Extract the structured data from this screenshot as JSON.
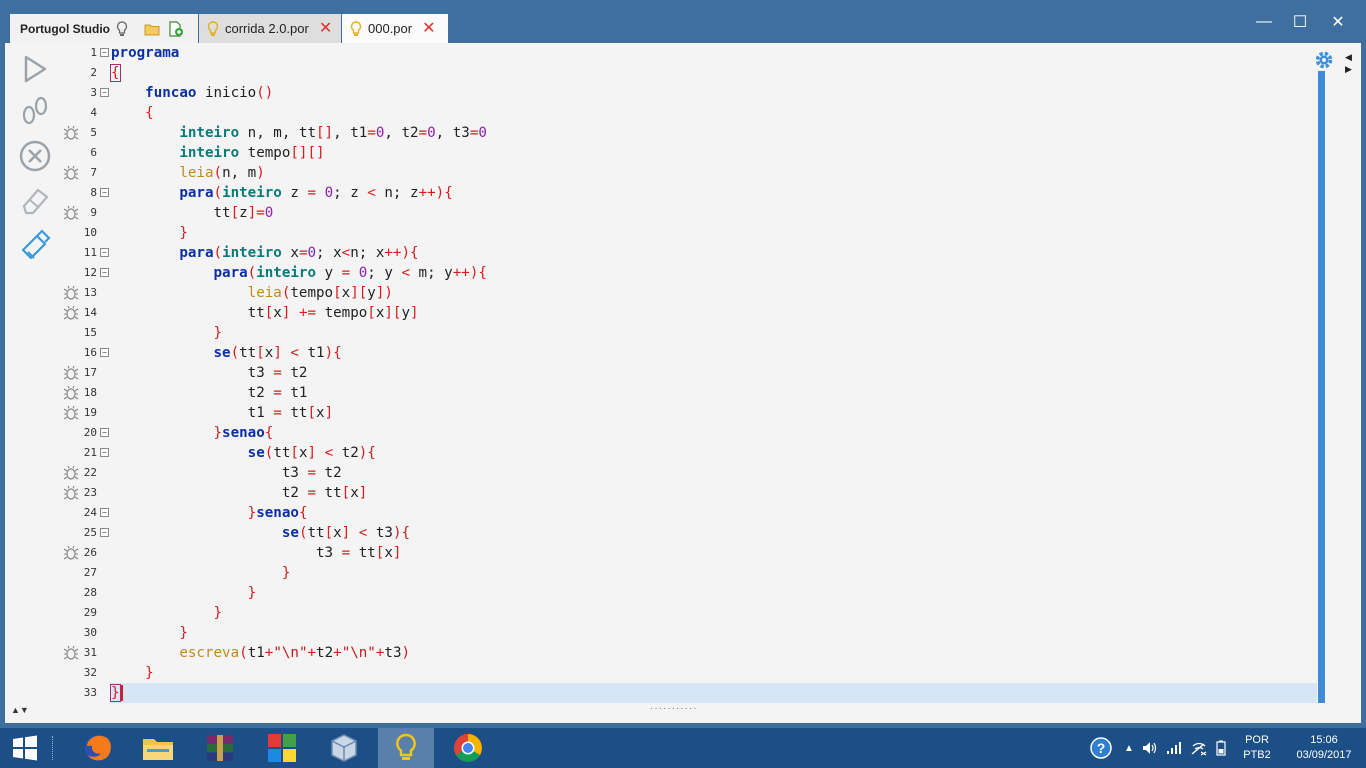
{
  "app": {
    "title": "Portugol Studio"
  },
  "tabs": [
    {
      "label": "corrida 2.0.por",
      "active": false
    },
    {
      "label": "000.por",
      "active": true
    }
  ],
  "window_controls": {
    "minimize": "—",
    "maximize": "☐",
    "close": "✕"
  },
  "toolbar": [
    {
      "name": "run-button",
      "icon": "play-icon"
    },
    {
      "name": "step-button",
      "icon": "footsteps-icon"
    },
    {
      "name": "stop-button",
      "icon": "stop-icon"
    },
    {
      "name": "edit-button",
      "icon": "eraser-icon"
    },
    {
      "name": "deploy-button",
      "icon": "usb-icon"
    }
  ],
  "editor": {
    "current_line": 33,
    "lines": [
      {
        "n": 1,
        "fold": true,
        "bug": false
      },
      {
        "n": 2,
        "fold": false,
        "bug": false
      },
      {
        "n": 3,
        "fold": true,
        "bug": false
      },
      {
        "n": 4,
        "fold": false,
        "bug": false
      },
      {
        "n": 5,
        "fold": false,
        "bug": true
      },
      {
        "n": 6,
        "fold": false,
        "bug": false
      },
      {
        "n": 7,
        "fold": false,
        "bug": true
      },
      {
        "n": 8,
        "fold": true,
        "bug": false
      },
      {
        "n": 9,
        "fold": false,
        "bug": true
      },
      {
        "n": 10,
        "fold": false,
        "bug": false
      },
      {
        "n": 11,
        "fold": true,
        "bug": false
      },
      {
        "n": 12,
        "fold": true,
        "bug": false
      },
      {
        "n": 13,
        "fold": false,
        "bug": true
      },
      {
        "n": 14,
        "fold": false,
        "bug": true
      },
      {
        "n": 15,
        "fold": false,
        "bug": false
      },
      {
        "n": 16,
        "fold": true,
        "bug": false
      },
      {
        "n": 17,
        "fold": false,
        "bug": true
      },
      {
        "n": 18,
        "fold": false,
        "bug": true
      },
      {
        "n": 19,
        "fold": false,
        "bug": true
      },
      {
        "n": 20,
        "fold": true,
        "bug": false
      },
      {
        "n": 21,
        "fold": true,
        "bug": false
      },
      {
        "n": 22,
        "fold": false,
        "bug": true
      },
      {
        "n": 23,
        "fold": false,
        "bug": true
      },
      {
        "n": 24,
        "fold": true,
        "bug": false
      },
      {
        "n": 25,
        "fold": true,
        "bug": false
      },
      {
        "n": 26,
        "fold": false,
        "bug": true
      },
      {
        "n": 27,
        "fold": false,
        "bug": false
      },
      {
        "n": 28,
        "fold": false,
        "bug": false
      },
      {
        "n": 29,
        "fold": false,
        "bug": false
      },
      {
        "n": 30,
        "fold": false,
        "bug": false
      },
      {
        "n": 31,
        "fold": false,
        "bug": true
      },
      {
        "n": 32,
        "fold": false,
        "bug": false
      },
      {
        "n": 33,
        "fold": false,
        "bug": false
      }
    ],
    "code": [
      [
        [
          "k",
          "programa"
        ]
      ],
      [
        [
          "b",
          "{"
        ]
      ],
      [
        [
          "p",
          "    "
        ],
        [
          "k",
          "funcao"
        ],
        [
          "p",
          " inicio"
        ],
        [
          "b",
          "()"
        ]
      ],
      [
        [
          "p",
          "    "
        ],
        [
          "b",
          "{"
        ]
      ],
      [
        [
          "p",
          "        "
        ],
        [
          "t",
          "inteiro"
        ],
        [
          "p",
          " n, m, tt"
        ],
        [
          "b",
          "[]"
        ],
        [
          "p",
          ", t1"
        ],
        [
          "o",
          "="
        ],
        [
          "n",
          "0"
        ],
        [
          "p",
          ", t2"
        ],
        [
          "o",
          "="
        ],
        [
          "n",
          "0"
        ],
        [
          "p",
          ", t3"
        ],
        [
          "o",
          "="
        ],
        [
          "n",
          "0"
        ]
      ],
      [
        [
          "p",
          "        "
        ],
        [
          "t",
          "inteiro"
        ],
        [
          "p",
          " tempo"
        ],
        [
          "b",
          "[][]"
        ]
      ],
      [
        [
          "p",
          "        "
        ],
        [
          "f",
          "leia"
        ],
        [
          "b",
          "("
        ],
        [
          "p",
          "n, m"
        ],
        [
          "b",
          ")"
        ]
      ],
      [
        [
          "p",
          "        "
        ],
        [
          "k",
          "para"
        ],
        [
          "b",
          "("
        ],
        [
          "t",
          "inteiro"
        ],
        [
          "p",
          " z "
        ],
        [
          "o",
          "="
        ],
        [
          "p",
          " "
        ],
        [
          "n",
          "0"
        ],
        [
          "p",
          "; z "
        ],
        [
          "o",
          "<"
        ],
        [
          "p",
          " n; z"
        ],
        [
          "o",
          "++"
        ],
        [
          "b",
          "){"
        ]
      ],
      [
        [
          "p",
          "            tt"
        ],
        [
          "b",
          "["
        ],
        [
          "p",
          "z"
        ],
        [
          "b",
          "]"
        ],
        [
          "o",
          "="
        ],
        [
          "n",
          "0"
        ]
      ],
      [
        [
          "p",
          "        "
        ],
        [
          "b",
          "}"
        ]
      ],
      [
        [
          "p",
          "        "
        ],
        [
          "k",
          "para"
        ],
        [
          "b",
          "("
        ],
        [
          "t",
          "inteiro"
        ],
        [
          "p",
          " x"
        ],
        [
          "o",
          "="
        ],
        [
          "n",
          "0"
        ],
        [
          "p",
          "; x"
        ],
        [
          "o",
          "<"
        ],
        [
          "p",
          "n; x"
        ],
        [
          "o",
          "++"
        ],
        [
          "b",
          "){"
        ]
      ],
      [
        [
          "p",
          "            "
        ],
        [
          "k",
          "para"
        ],
        [
          "b",
          "("
        ],
        [
          "t",
          "inteiro"
        ],
        [
          "p",
          " y "
        ],
        [
          "o",
          "="
        ],
        [
          "p",
          " "
        ],
        [
          "n",
          "0"
        ],
        [
          "p",
          "; y "
        ],
        [
          "o",
          "<"
        ],
        [
          "p",
          " m; y"
        ],
        [
          "o",
          "++"
        ],
        [
          "b",
          "){"
        ]
      ],
      [
        [
          "p",
          "                "
        ],
        [
          "f",
          "leia"
        ],
        [
          "b",
          "("
        ],
        [
          "p",
          "tempo"
        ],
        [
          "b",
          "["
        ],
        [
          "p",
          "x"
        ],
        [
          "b",
          "]["
        ],
        [
          "p",
          "y"
        ],
        [
          "b",
          "])"
        ]
      ],
      [
        [
          "p",
          "                tt"
        ],
        [
          "b",
          "["
        ],
        [
          "p",
          "x"
        ],
        [
          "b",
          "]"
        ],
        [
          "p",
          " "
        ],
        [
          "o",
          "+="
        ],
        [
          "p",
          " tempo"
        ],
        [
          "b",
          "["
        ],
        [
          "p",
          "x"
        ],
        [
          "b",
          "]["
        ],
        [
          "p",
          "y"
        ],
        [
          "b",
          "]"
        ]
      ],
      [
        [
          "p",
          "            "
        ],
        [
          "b",
          "}"
        ]
      ],
      [
        [
          "p",
          "            "
        ],
        [
          "k",
          "se"
        ],
        [
          "b",
          "("
        ],
        [
          "p",
          "tt"
        ],
        [
          "b",
          "["
        ],
        [
          "p",
          "x"
        ],
        [
          "b",
          "]"
        ],
        [
          "p",
          " "
        ],
        [
          "o",
          "<"
        ],
        [
          "p",
          " t1"
        ],
        [
          "b",
          "){"
        ]
      ],
      [
        [
          "p",
          "                t3 "
        ],
        [
          "o",
          "="
        ],
        [
          "p",
          " t2"
        ]
      ],
      [
        [
          "p",
          "                t2 "
        ],
        [
          "o",
          "="
        ],
        [
          "p",
          " t1"
        ]
      ],
      [
        [
          "p",
          "                t1 "
        ],
        [
          "o",
          "="
        ],
        [
          "p",
          " tt"
        ],
        [
          "b",
          "["
        ],
        [
          "p",
          "x"
        ],
        [
          "b",
          "]"
        ]
      ],
      [
        [
          "p",
          "            "
        ],
        [
          "b",
          "}"
        ],
        [
          "k",
          "senao"
        ],
        [
          "b",
          "{"
        ]
      ],
      [
        [
          "p",
          "                "
        ],
        [
          "k",
          "se"
        ],
        [
          "b",
          "("
        ],
        [
          "p",
          "tt"
        ],
        [
          "b",
          "["
        ],
        [
          "p",
          "x"
        ],
        [
          "b",
          "]"
        ],
        [
          "p",
          " "
        ],
        [
          "o",
          "<"
        ],
        [
          "p",
          " t2"
        ],
        [
          "b",
          "){"
        ]
      ],
      [
        [
          "p",
          "                    t3 "
        ],
        [
          "o",
          "="
        ],
        [
          "p",
          " t2"
        ]
      ],
      [
        [
          "p",
          "                    t2 "
        ],
        [
          "o",
          "="
        ],
        [
          "p",
          " tt"
        ],
        [
          "b",
          "["
        ],
        [
          "p",
          "x"
        ],
        [
          "b",
          "]"
        ]
      ],
      [
        [
          "p",
          "                "
        ],
        [
          "b",
          "}"
        ],
        [
          "k",
          "senao"
        ],
        [
          "b",
          "{"
        ]
      ],
      [
        [
          "p",
          "                    "
        ],
        [
          "k",
          "se"
        ],
        [
          "b",
          "("
        ],
        [
          "p",
          "tt"
        ],
        [
          "b",
          "["
        ],
        [
          "p",
          "x"
        ],
        [
          "b",
          "]"
        ],
        [
          "p",
          " "
        ],
        [
          "o",
          "<"
        ],
        [
          "p",
          " t3"
        ],
        [
          "b",
          "){"
        ]
      ],
      [
        [
          "p",
          "                        t3 "
        ],
        [
          "o",
          "="
        ],
        [
          "p",
          " tt"
        ],
        [
          "b",
          "["
        ],
        [
          "p",
          "x"
        ],
        [
          "b",
          "]"
        ]
      ],
      [
        [
          "p",
          "                    "
        ],
        [
          "b",
          "}"
        ]
      ],
      [
        [
          "p",
          "                "
        ],
        [
          "b",
          "}"
        ]
      ],
      [
        [
          "p",
          "            "
        ],
        [
          "b",
          "}"
        ]
      ],
      [
        [
          "p",
          "        "
        ],
        [
          "b",
          "}"
        ]
      ],
      [
        [
          "p",
          "        "
        ],
        [
          "f",
          "escreva"
        ],
        [
          "b",
          "("
        ],
        [
          "p",
          "t1"
        ],
        [
          "o",
          "+"
        ],
        [
          "s",
          "\"\\n\""
        ],
        [
          "o",
          "+"
        ],
        [
          "p",
          "t2"
        ],
        [
          "o",
          "+"
        ],
        [
          "s",
          "\"\\n\""
        ],
        [
          "o",
          "+"
        ],
        [
          "p",
          "t3"
        ],
        [
          "b",
          ")"
        ]
      ],
      [
        [
          "p",
          "    "
        ],
        [
          "b",
          "}"
        ]
      ],
      [
        [
          "b",
          "}"
        ]
      ]
    ]
  },
  "taskbar": {
    "apps": [
      {
        "name": "firefox"
      },
      {
        "name": "file-explorer"
      },
      {
        "name": "winrar"
      },
      {
        "name": "windows-store"
      },
      {
        "name": "virtualbox"
      },
      {
        "name": "portugol-studio",
        "active": true
      },
      {
        "name": "chrome"
      }
    ],
    "tray": {
      "language": "POR",
      "layout": "PTB2",
      "time": "15:06",
      "date": "03/09/2017"
    }
  },
  "colors": {
    "title_bar": "#3e6f9e",
    "taskbar": "#1d4f87",
    "keyword": "#0b2fa7",
    "type": "#0b7a7a",
    "function": "#c08a1e",
    "number": "#8c1fb0",
    "bracket": "#d81b1b",
    "current_line": "#d6e6f7"
  }
}
